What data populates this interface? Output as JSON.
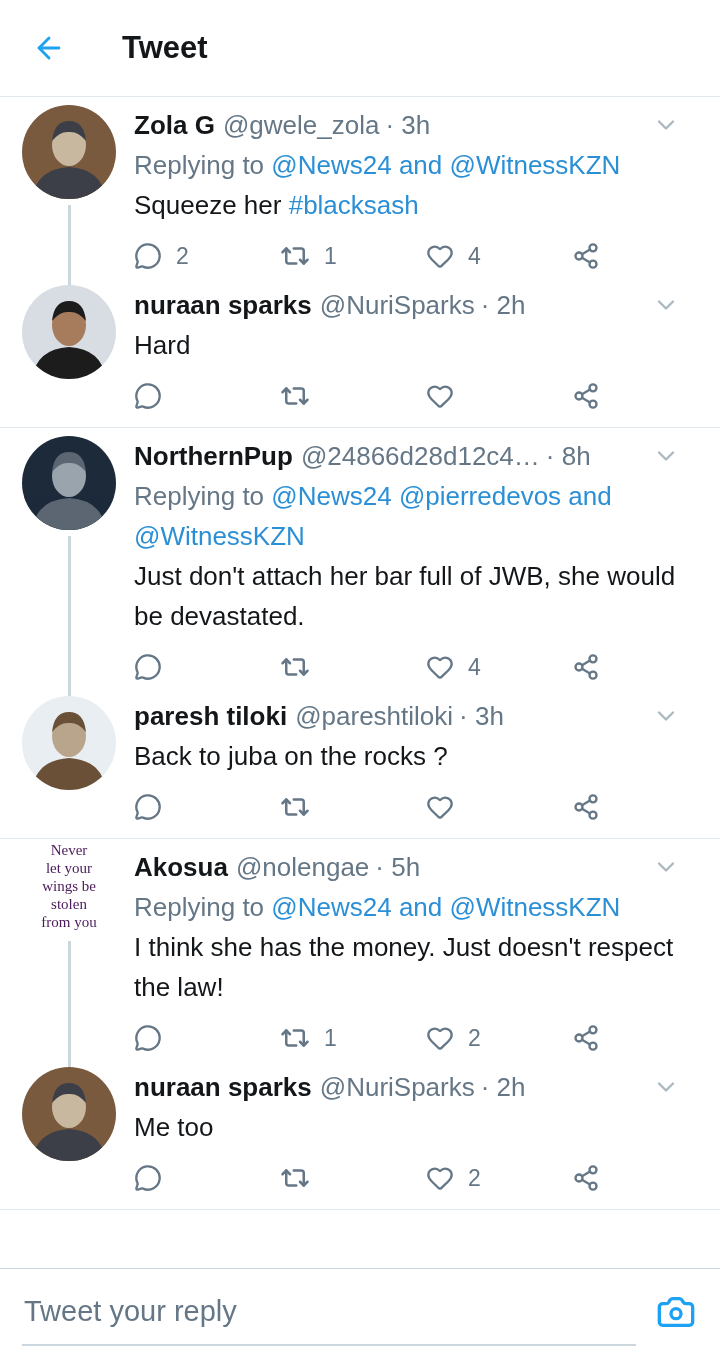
{
  "header": {
    "title": "Tweet"
  },
  "threads": [
    {
      "tweets": [
        {
          "name": "Zola G",
          "handle": "@gwele_zola",
          "time": "· 3h",
          "avatar": {
            "kind": "picture"
          },
          "replying_label": "Replying to",
          "replying_to": [
            "@News24",
            "and",
            "@WitnessKZN"
          ],
          "text": [
            {
              "kind": "plain",
              "text": "Squeeze her "
            },
            {
              "kind": "hashtag",
              "text": "#blacksash"
            }
          ],
          "counts": {
            "reply": "2",
            "retweet": "1",
            "like": "4"
          },
          "thread_line": true
        },
        {
          "name": "nuraan sparks",
          "handle": "@NuriSparks",
          "time": "· 2h",
          "avatar": {
            "kind": "picture"
          },
          "text": [
            {
              "kind": "plain",
              "text": "Hard"
            }
          ],
          "thread_line": false
        }
      ]
    },
    {
      "tweets": [
        {
          "name": "NorthernPup",
          "handle": "@24866d28d12c4…",
          "time": "· 8h",
          "avatar": {
            "kind": "picture"
          },
          "replying_label": "Replying to",
          "replying_to": [
            "@News24",
            "@pierredevos",
            "and",
            "@WitnessKZN"
          ],
          "text": [
            {
              "kind": "plain",
              "text": "Just don't attach her bar full of JWB, she would be devastated."
            }
          ],
          "counts": {
            "like": "4"
          },
          "thread_line": true
        },
        {
          "name": "paresh tiloki",
          "handle": "@pareshtiloki",
          "time": "· 3h",
          "avatar": {
            "kind": "picture"
          },
          "text": [
            {
              "kind": "plain",
              "text": "Back to juba on the rocks ?"
            }
          ],
          "thread_line": false
        }
      ]
    },
    {
      "tweets": [
        {
          "name": "Akosua",
          "handle": "@nolengae",
          "time": "· 5h",
          "avatar": {
            "kind": "quote",
            "lines": [
              "Never",
              "let your",
              "wings be",
              "stolen",
              "from you"
            ]
          },
          "replying_label": "Replying to",
          "replying_to": [
            "@News24",
            "and",
            "@WitnessKZN"
          ],
          "text": [
            {
              "kind": "plain",
              "text": "I think she has the money. Just doesn't respect the law!"
            }
          ],
          "counts": {
            "retweet": "1",
            "like": "2"
          },
          "thread_line": true
        },
        {
          "name": "nuraan sparks",
          "handle": "@NuriSparks",
          "time": "· 2h",
          "avatar": {
            "kind": "picture"
          },
          "text": [
            {
              "kind": "plain",
              "text": "Me too"
            }
          ],
          "counts": {
            "like": "2"
          },
          "thread_line": false
        }
      ]
    }
  ],
  "reply_bar": {
    "placeholder": "Tweet your reply"
  }
}
